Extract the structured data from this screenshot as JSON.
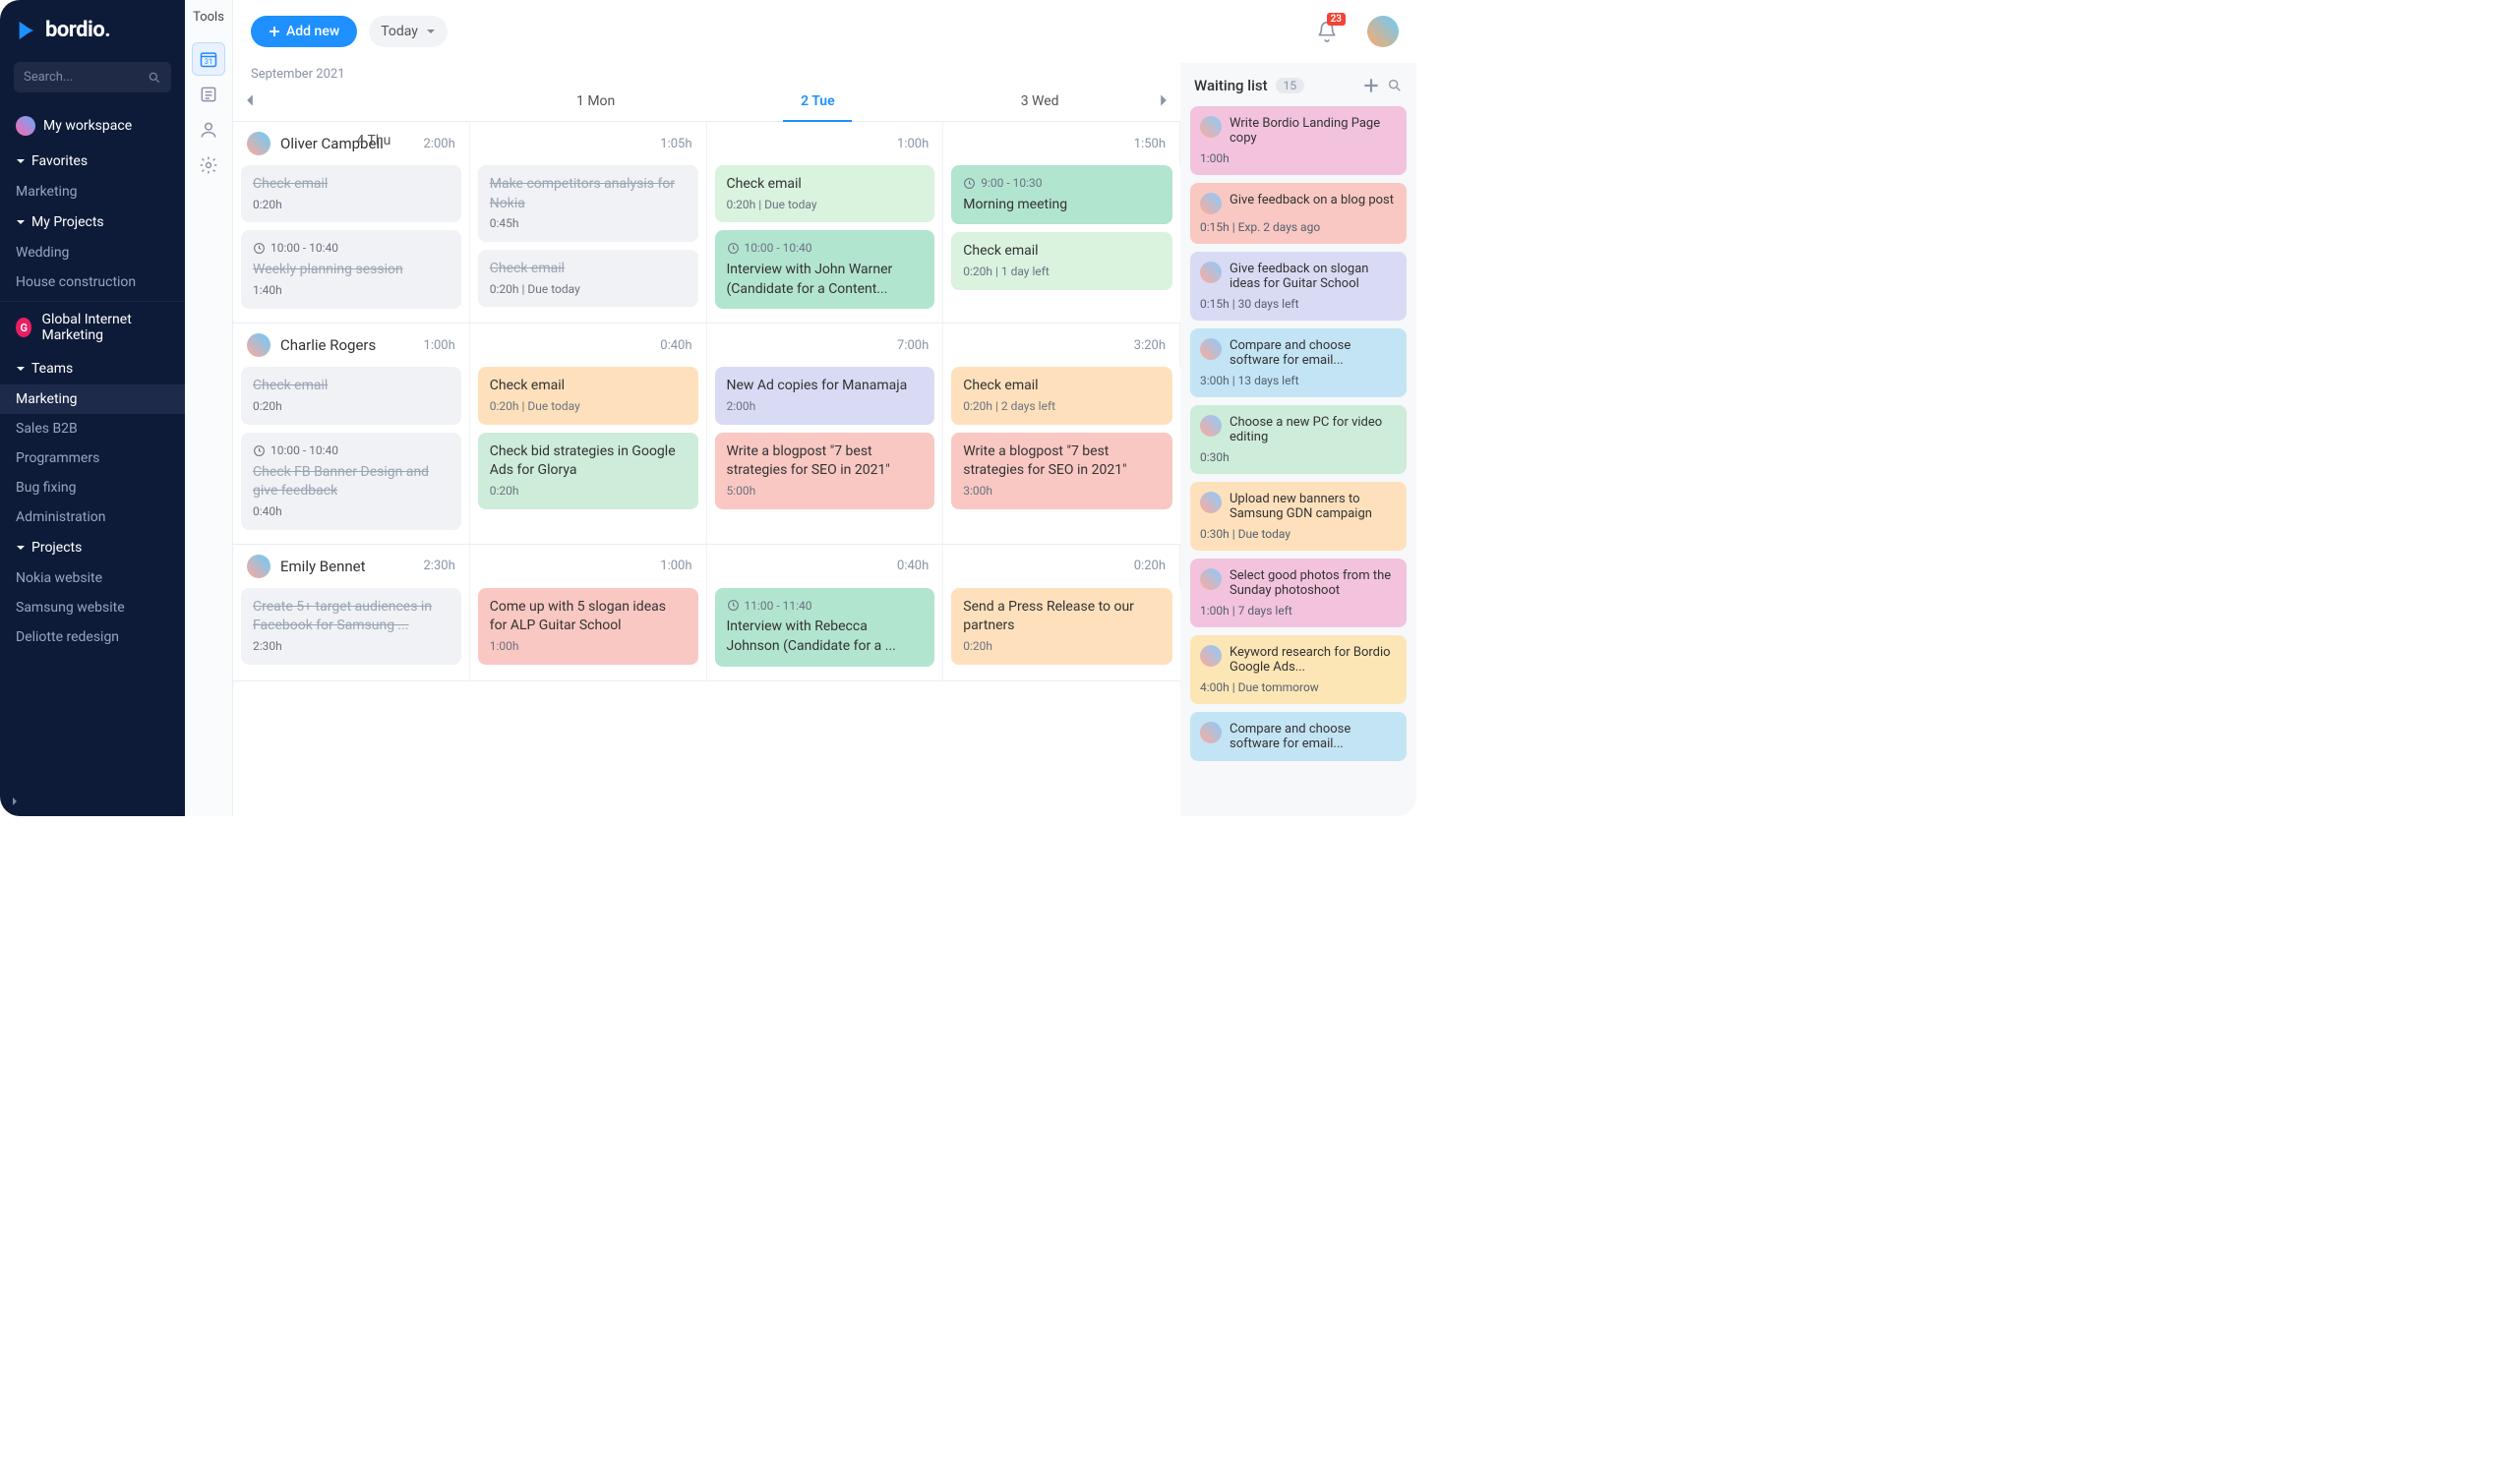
{
  "brand": {
    "name": "bordio."
  },
  "search": {
    "placeholder": "Search..."
  },
  "workspace": {
    "label": "My workspace"
  },
  "sidebar": {
    "favorites": {
      "label": "Favorites",
      "items": [
        "Marketing"
      ]
    },
    "myProjects": {
      "label": "My Projects",
      "items": [
        "Wedding",
        "House construction"
      ]
    },
    "org": {
      "initial": "G",
      "name": "Global Internet Marketing"
    },
    "teams": {
      "label": "Teams",
      "items": [
        "Marketing",
        "Sales B2B",
        "Programmers",
        "Bug fixing",
        "Administration"
      ],
      "activeIndex": 0
    },
    "projects": {
      "label": "Projects",
      "items": [
        "Nokia website",
        "Samsung website",
        "Deliotte redesign"
      ]
    }
  },
  "rail": {
    "title": "Tools"
  },
  "topbar": {
    "addLabel": "Add new",
    "todayLabel": "Today",
    "notifCount": "23"
  },
  "board": {
    "monthLabel": "September 2021",
    "days": [
      {
        "label": "1 Mon"
      },
      {
        "label": "2 Tue",
        "active": true
      },
      {
        "label": "3 Wed"
      },
      {
        "label": "4 Thu"
      }
    ],
    "people": [
      {
        "name": "Oliver Campbell",
        "totals": [
          "2:00h",
          "1:05h",
          "1:00h",
          "1:50h"
        ],
        "cols": [
          [
            {
              "title": "Check email",
              "meta": "0:20h",
              "color": "c-gray",
              "done": true
            },
            {
              "time": "10:00 - 10:40",
              "title": "Weekly planning session",
              "meta": "1:40h",
              "color": "c-gray",
              "done": true
            }
          ],
          [
            {
              "title": "Make competitors analysis for Nokia",
              "meta": "0:45h",
              "color": "c-gray",
              "done": true
            },
            {
              "title": "Check email",
              "meta": "0:20h | Due today",
              "color": "c-gray",
              "done": true
            }
          ],
          [
            {
              "title": "Check email",
              "meta": "0:20h | Due today",
              "color": "c-lgreen"
            },
            {
              "time": "10:00 - 10:40",
              "title": "Interview with John Warner (Candidate for a Content...",
              "meta": "",
              "color": "c-teal"
            }
          ],
          [
            {
              "time": "9:00 - 10:30",
              "title": "Morning meeting",
              "meta": "",
              "color": "c-teal"
            },
            {
              "title": "Check email",
              "meta": "0:20h | 1 day left",
              "color": "c-lgreen"
            }
          ]
        ]
      },
      {
        "name": "Charlie Rogers",
        "totals": [
          "1:00h",
          "0:40h",
          "7:00h",
          "3:20h"
        ],
        "cols": [
          [
            {
              "title": "Check email",
              "meta": "0:20h",
              "color": "c-gray",
              "done": true
            },
            {
              "time": "10:00 - 10:40",
              "title": "Check FB Banner Design and give feedback",
              "meta": "0:40h",
              "color": "c-gray",
              "done": true
            }
          ],
          [
            {
              "title": "Check email",
              "meta": "0:20h | Due today",
              "color": "c-orange"
            },
            {
              "title": "Check bid strategies in Google Ads for Glorya",
              "meta": "0:20h",
              "color": "c-green"
            }
          ],
          [
            {
              "title": "New Ad copies for Manamaja",
              "meta": "2:00h",
              "color": "c-purple"
            },
            {
              "title": "Write a blogpost \"7 best strategies for SEO in 2021\"",
              "meta": "5:00h",
              "color": "c-red"
            }
          ],
          [
            {
              "title": "Check email",
              "meta": "0:20h | 2 days left",
              "color": "c-orange"
            },
            {
              "title": "Write a blogpost \"7 best strategies for SEO in 2021\"",
              "meta": "3:00h",
              "color": "c-red"
            }
          ]
        ]
      },
      {
        "name": "Emily Bennet",
        "totals": [
          "2:30h",
          "1:00h",
          "0:40h",
          "0:20h"
        ],
        "cols": [
          [
            {
              "title": "Create 5+ target audiences in Facebook for Samsung ...",
              "meta": "2:30h",
              "color": "c-gray",
              "done": true
            }
          ],
          [
            {
              "title": "Come up with 5 slogan ideas for ALP Guitar School",
              "meta": "1:00h",
              "color": "c-red"
            }
          ],
          [
            {
              "time": "11:00 - 11:40",
              "title": "Interview with Rebecca Johnson (Candidate for a ...",
              "meta": "",
              "color": "c-teal"
            }
          ],
          [
            {
              "title": "Send a Press Release to our partners",
              "meta": "0:20h",
              "color": "c-orange"
            }
          ]
        ]
      }
    ]
  },
  "waiting": {
    "title": "Waiting list",
    "count": "15",
    "items": [
      {
        "title": "Write Bordio Landing Page copy",
        "meta": "1:00h",
        "color": "c-pink"
      },
      {
        "title": "Give feedback on a blog post",
        "meta": "0:15h | Exp. 2 days ago",
        "color": "c-red"
      },
      {
        "title": "Give feedback on slogan ideas for Guitar School",
        "meta": "0:15h | 30 days left",
        "color": "c-purple"
      },
      {
        "title": "Compare and choose software for email...",
        "meta": "3:00h | 13 days left",
        "color": "c-blue"
      },
      {
        "title": "Choose a new PC for video editing",
        "meta": "0:30h",
        "color": "c-green"
      },
      {
        "title": "Upload new banners to Samsung GDN campaign",
        "meta": "0:30h | Due today",
        "color": "c-orange"
      },
      {
        "title": "Select good photos from the Sunday photoshoot",
        "meta": "1:00h | 7 days left",
        "color": "c-pink"
      },
      {
        "title": "Keyword research for Bordio Google Ads...",
        "meta": "4:00h | Due tommorow",
        "color": "c-yellow"
      },
      {
        "title": "Compare and choose software for email...",
        "meta": "",
        "color": "c-blue"
      }
    ]
  }
}
